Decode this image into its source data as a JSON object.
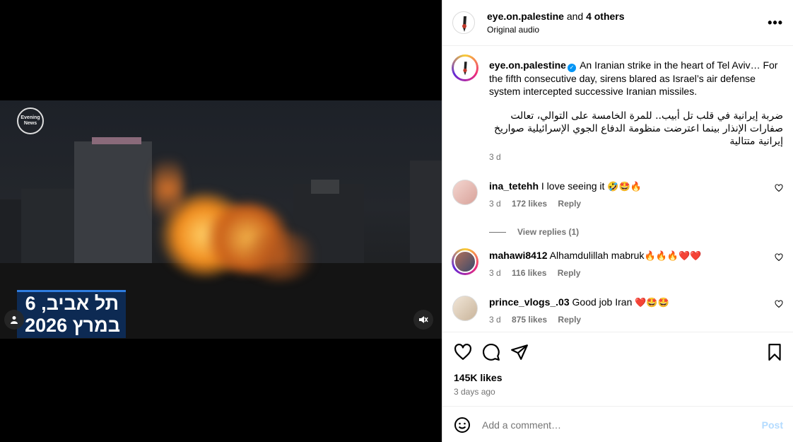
{
  "video": {
    "logo_text": "Evening News",
    "caption_line1": "תל אביב, 6",
    "caption_line2": "במרץ 2026"
  },
  "header": {
    "username": "eye.on.palestine",
    "and_text": "and",
    "others": "4 others",
    "audio": "Original audio",
    "more_icon": "more-horizontal-icon"
  },
  "caption": {
    "username": "eye.on.palestine",
    "text_en": "An Iranian strike in the heart of Tel Aviv… For the fifth consecutive day, sirens blared as Israel’s air defense system intercepted successive Iranian missiles.",
    "text_ar": "ضربة إيرانية في قلب تل أبيب.. للمرة الخامسة على التوالي، تعالت صفارات الإنذار بينما اعترضت منظومة الدفاع الجوي الإسرائيلية صواريخ إيرانية متتالية",
    "time": "3 d"
  },
  "comments": [
    {
      "username": "ina_tetehh",
      "text": "I love seeing it",
      "emoji": "🤣🤩🔥",
      "time": "3 d",
      "likes": "172 likes",
      "reply": "Reply",
      "view_replies": "View replies (1)"
    },
    {
      "username": "mahawi8412",
      "text": "Alhamdulillah mabruk",
      "emoji": "🔥🔥🔥❤️❤️",
      "time": "3 d",
      "likes": "116 likes",
      "reply": "Reply"
    },
    {
      "username": "prince_vlogs_.03",
      "text": "Good job Iran",
      "emoji": "❤️🤩🤩",
      "time": "3 d",
      "likes": "875 likes",
      "reply": "Reply"
    }
  ],
  "actions": {
    "likes": "145K likes",
    "posted": "3 days ago"
  },
  "add_comment": {
    "placeholder": "Add a comment…",
    "post_label": "Post"
  },
  "colors": {
    "accent": "#0095f6",
    "muted": "#737373",
    "post_disabled": "#b3dbff"
  }
}
